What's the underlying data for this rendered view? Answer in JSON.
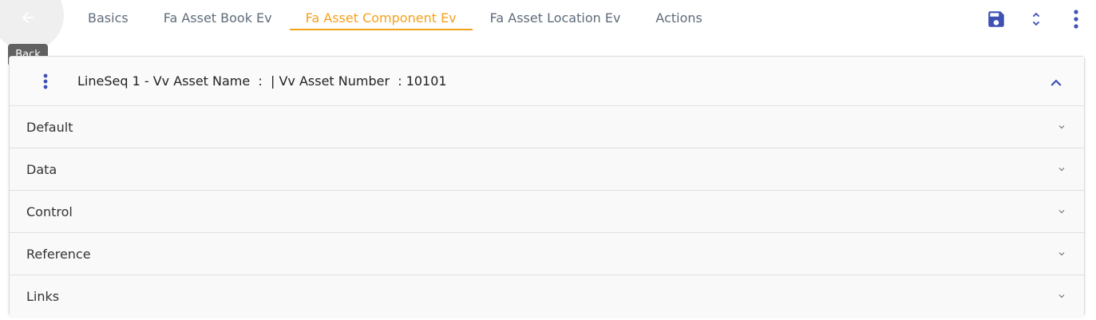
{
  "back": {
    "tooltip": "Back",
    "icon": "arrow-left-icon"
  },
  "tabs": [
    {
      "label": "Basics",
      "active": false
    },
    {
      "label": "Fa Asset Book Ev",
      "active": false
    },
    {
      "label": "Fa Asset Component Ev",
      "active": true
    },
    {
      "label": "Fa Asset Location Ev",
      "active": false
    },
    {
      "label": "Actions",
      "active": false
    }
  ],
  "toolbar": {
    "save_icon": "save-icon",
    "expand_collapse_icon": "unfold-icon",
    "more_icon": "more-vertical-icon"
  },
  "panel": {
    "title": "LineSeq 1 - Vv Asset Name  :  | Vv Asset Number  : 10101",
    "sections": [
      {
        "label": "Default"
      },
      {
        "label": "Data"
      },
      {
        "label": "Control"
      },
      {
        "label": "Reference"
      },
      {
        "label": "Links"
      }
    ]
  },
  "colors": {
    "accent": "#f5a11c",
    "icon_blue": "#3f51b5",
    "tab_text": "#5f6b7a",
    "tooltip_bg": "#616161"
  }
}
